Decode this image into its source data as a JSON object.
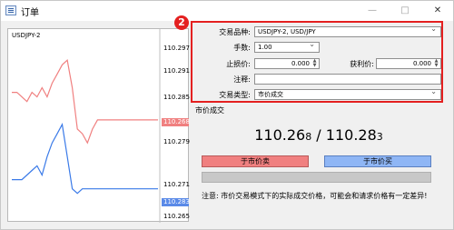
{
  "window": {
    "title": "订单",
    "minimize_glyph": "—",
    "maximize_glyph": "□",
    "close_glyph": "✕"
  },
  "callout": {
    "number": "2",
    "color": "#e42020"
  },
  "chart": {
    "symbol": "USDJPY-2",
    "ticks": [
      "110.297",
      "110.291",
      "110.285",
      "110.279",
      "110.271",
      "110.265"
    ],
    "bid_tag": "110.268",
    "ask_tag": "110.283",
    "colors": {
      "bid": "#f08080",
      "ask": "#3a7ae8"
    }
  },
  "chart_data": {
    "type": "line",
    "title": "USDJPY-2",
    "xlabel": "",
    "ylabel": "",
    "ylim": [
      110.262,
      110.3
    ],
    "yticks": [
      110.297,
      110.291,
      110.285,
      110.279,
      110.271,
      110.265
    ],
    "series": [
      {
        "name": "",
        "color": "#f08080",
        "values": [
          110.289,
          110.289,
          110.288,
          110.287,
          110.289,
          110.288,
          110.29,
          110.288,
          110.291,
          110.293,
          110.295,
          110.296,
          110.29,
          110.281,
          110.28,
          110.278,
          110.281,
          110.283,
          110.283,
          110.283,
          110.283,
          110.283,
          110.283,
          110.283,
          110.283,
          110.283,
          110.283,
          110.283,
          110.283,
          110.283
        ]
      },
      {
        "name": "",
        "color": "#3a7ae8",
        "values": [
          110.27,
          110.27,
          110.27,
          110.271,
          110.272,
          110.273,
          110.271,
          110.275,
          110.278,
          110.28,
          110.282,
          110.275,
          110.268,
          110.267,
          110.268,
          110.268,
          110.268,
          110.268,
          110.268,
          110.268,
          110.268,
          110.268,
          110.268,
          110.268,
          110.268,
          110.268,
          110.268,
          110.268,
          110.268,
          110.268
        ]
      }
    ]
  },
  "form": {
    "symbol_label": "交易品种:",
    "symbol_value": "USDJPY-2, USD/JPY",
    "volume_label": "手数:",
    "volume_value": "1.00",
    "stoploss_label": "止损价:",
    "stoploss_value": "0.000",
    "takeprofit_label": "获利价:",
    "takeprofit_value": "0.000",
    "comment_label": "注释:",
    "comment_value": "",
    "type_label": "交易类型:",
    "type_value": "市价成交"
  },
  "market": {
    "section_label": "市价成交",
    "bid_main": "110.26",
    "bid_last": "8",
    "separator": " / ",
    "ask_main": "110.28",
    "ask_last": "3",
    "sell_label": "于市价卖",
    "buy_label": "于市价买",
    "notice": "注意: 市价交易模式下的实际成交价格，可能会和请求价格有一定差异!"
  }
}
